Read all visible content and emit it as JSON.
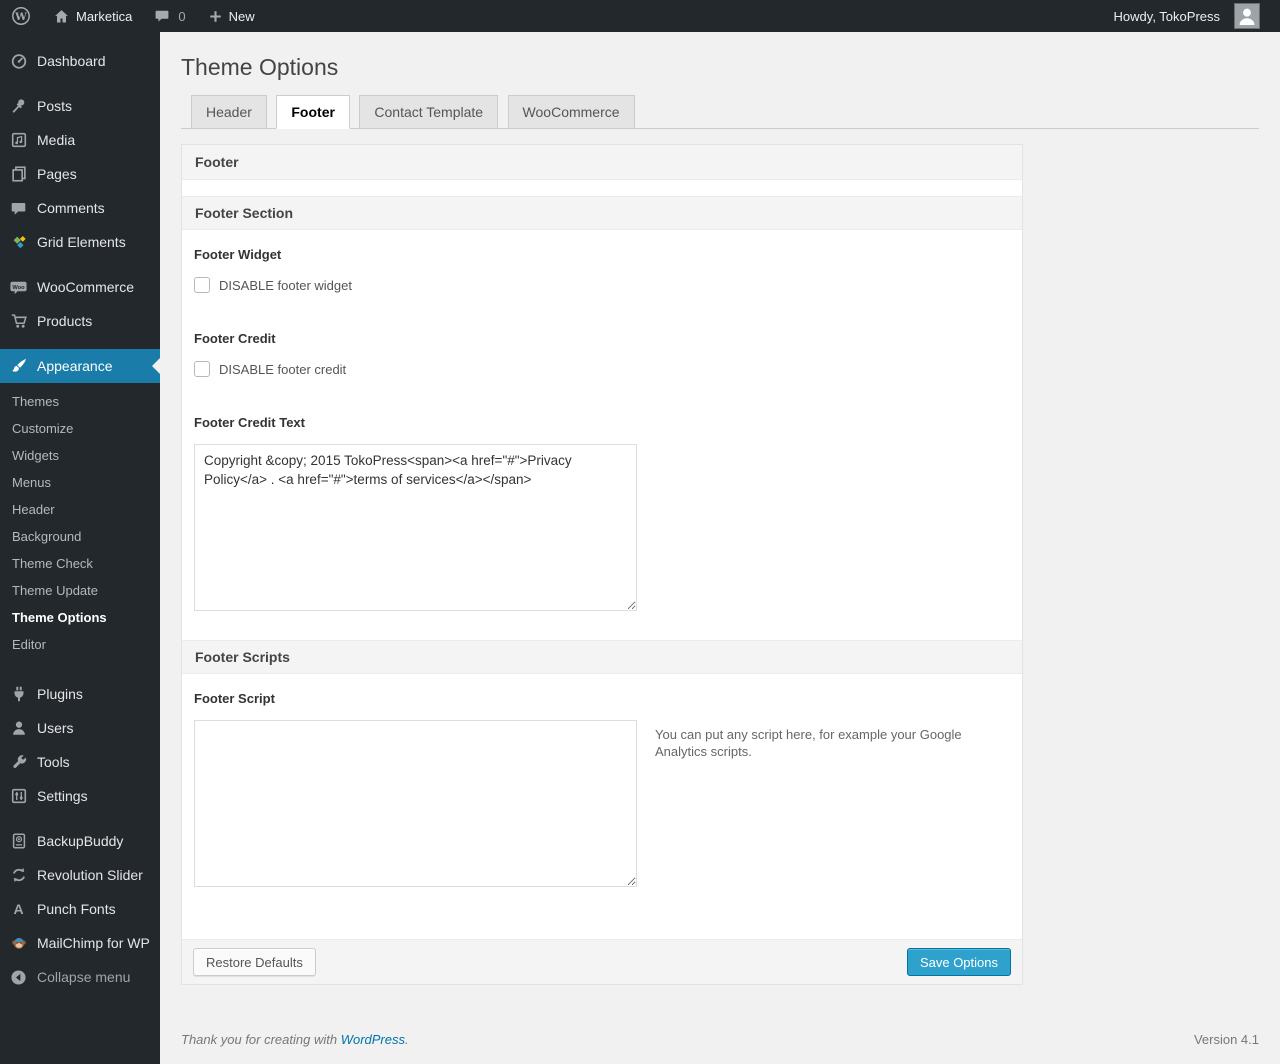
{
  "admin_bar": {
    "site_name": "Marketica",
    "comment_count": "0",
    "new_label": "New",
    "howdy": "Howdy, TokoPress"
  },
  "sidebar": {
    "items": [
      {
        "label": "Dashboard",
        "icon": "dashboard-icon"
      },
      {
        "label": "Posts",
        "icon": "pin-icon"
      },
      {
        "label": "Media",
        "icon": "media-icon"
      },
      {
        "label": "Pages",
        "icon": "pages-icon"
      },
      {
        "label": "Comments",
        "icon": "comment-icon"
      },
      {
        "label": "Grid Elements",
        "icon": "grid-elements-icon"
      },
      {
        "label": "WooCommerce",
        "icon": "woocommerce-icon"
      },
      {
        "label": "Products",
        "icon": "cart-icon"
      },
      {
        "label": "Appearance",
        "icon": "brush-icon",
        "active": true
      },
      {
        "label": "Plugins",
        "icon": "plugin-icon"
      },
      {
        "label": "Users",
        "icon": "user-icon"
      },
      {
        "label": "Tools",
        "icon": "wrench-icon"
      },
      {
        "label": "Settings",
        "icon": "sliders-icon"
      },
      {
        "label": "BackupBuddy",
        "icon": "backup-drive-icon"
      },
      {
        "label": "Revolution Slider",
        "icon": "refresh-arrows-icon"
      },
      {
        "label": "Punch Fonts",
        "icon": "letter-a-icon"
      },
      {
        "label": "MailChimp for WP",
        "icon": "mailchimp-monkey-icon"
      },
      {
        "label": "Collapse menu",
        "icon": "collapse-arrow-icon"
      }
    ],
    "appearance_submenu": [
      {
        "label": "Themes"
      },
      {
        "label": "Customize"
      },
      {
        "label": "Widgets"
      },
      {
        "label": "Menus"
      },
      {
        "label": "Header"
      },
      {
        "label": "Background"
      },
      {
        "label": "Theme Check"
      },
      {
        "label": "Theme Update"
      },
      {
        "label": "Theme Options",
        "current": true
      },
      {
        "label": "Editor"
      }
    ]
  },
  "page": {
    "title": "Theme Options",
    "tabs": [
      {
        "label": "Header",
        "active": false
      },
      {
        "label": "Footer",
        "active": true
      },
      {
        "label": "Contact Template",
        "active": false
      },
      {
        "label": "WooCommerce",
        "active": false
      }
    ]
  },
  "panel": {
    "box_title": "Footer",
    "section_title": "Footer Section",
    "footer_widget_label": "Footer Widget",
    "footer_widget_checkbox_label": "DISABLE footer widget",
    "footer_credit_label": "Footer Credit",
    "footer_credit_checkbox_label": "DISABLE footer credit",
    "footer_credit_text_label": "Footer Credit Text",
    "footer_credit_text_value": "Copyright &copy; 2015 TokoPress<span><a href=\"#\">Privacy Policy</a> . <a href=\"#\">terms of services</a></span>",
    "scripts_section_title": "Footer Scripts",
    "footer_script_label": "Footer Script",
    "footer_script_value": "",
    "footer_script_help": "You can put any script here, for example your Google Analytics scripts.",
    "restore_button": "Restore Defaults",
    "save_button": "Save Options"
  },
  "page_footer": {
    "thanks_prefix": "Thank you for creating with ",
    "wordpress_link": "WordPress",
    "thanks_suffix": ".",
    "version": "Version 4.1"
  },
  "colors": {
    "accent_blue": "#2ea2cc",
    "menu_highlight": "#1a7ca8",
    "link_blue": "#0073aa",
    "admin_dark": "#23282d",
    "page_bg": "#f1f1f1"
  }
}
